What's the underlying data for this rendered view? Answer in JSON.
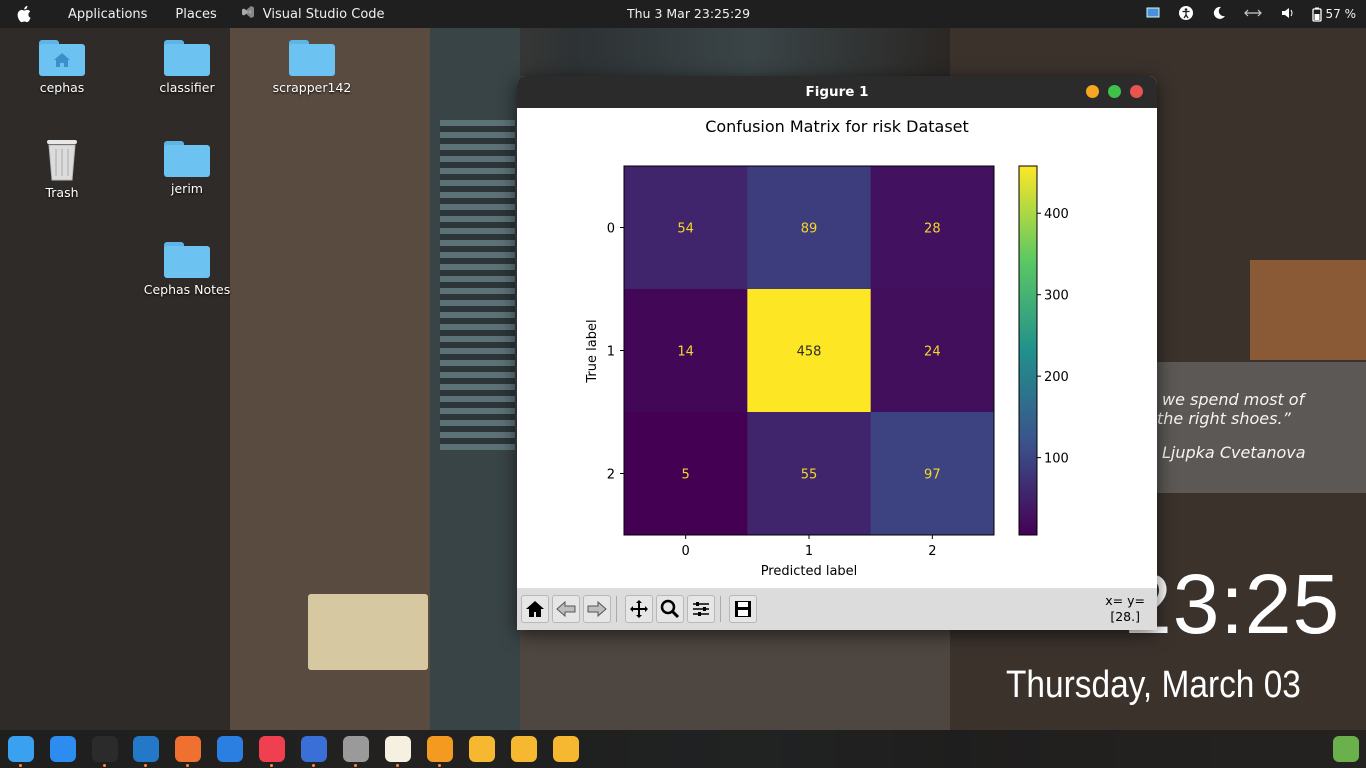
{
  "topbar": {
    "menu": [
      "Applications",
      "Places"
    ],
    "active_app": "Visual Studio Code",
    "datetime": "Thu 3 Mar  23:25:29",
    "battery": "57 %"
  },
  "desktop_icons": [
    {
      "label": "cephas",
      "kind": "home-folder"
    },
    {
      "label": "classifier",
      "kind": "folder"
    },
    {
      "label": "scrapper142",
      "kind": "folder"
    },
    {
      "label": "Trash",
      "kind": "trash"
    },
    {
      "label": "jerim",
      "kind": "folder"
    },
    {
      "label": "Cephas Notes",
      "kind": "folder"
    }
  ],
  "quote": {
    "line1": "we spend most of",
    "line2": "the right shoes.”",
    "author": "Ljupka Cvetanova"
  },
  "clock_widget": {
    "time": "23:25",
    "date": "Thursday, March 03"
  },
  "figure_window": {
    "title": "Figure 1",
    "toolbar": [
      "home-icon",
      "back-icon",
      "forward-icon",
      "pan-icon",
      "zoom-icon",
      "configure-icon",
      "save-icon"
    ],
    "coords_line1": "x= y=",
    "coords_line2": "[28.]"
  },
  "chart_data": {
    "type": "heatmap",
    "title": "Confusion Matrix for risk Dataset",
    "xlabel": "Predicted label",
    "ylabel": "True label",
    "x_categories": [
      "0",
      "1",
      "2"
    ],
    "y_categories": [
      "0",
      "1",
      "2"
    ],
    "values": [
      [
        54,
        89,
        28
      ],
      [
        14,
        458,
        24
      ],
      [
        5,
        55,
        97
      ]
    ],
    "colormap": "viridis",
    "colorbar_ticks": [
      100,
      200,
      300,
      400
    ],
    "colorbar_range": [
      5,
      458
    ]
  },
  "dock_icons": [
    "finder-icon",
    "app-store-icon",
    "terminal-icon",
    "vscode-icon",
    "compass-icon",
    "firefox-icon",
    "music-icon",
    "firefox-dev-icon",
    "settings-icon",
    "notes-icon",
    "books-icon",
    "folder-icon",
    "folder-icon",
    "folder-icon",
    "apps-grid-icon"
  ],
  "colors": {
    "topbar": "#1f1f1f",
    "folder": "#6cc3f2",
    "close": "#e8544f",
    "minimize": "#f5a623",
    "maximize": "#3fc24c"
  }
}
